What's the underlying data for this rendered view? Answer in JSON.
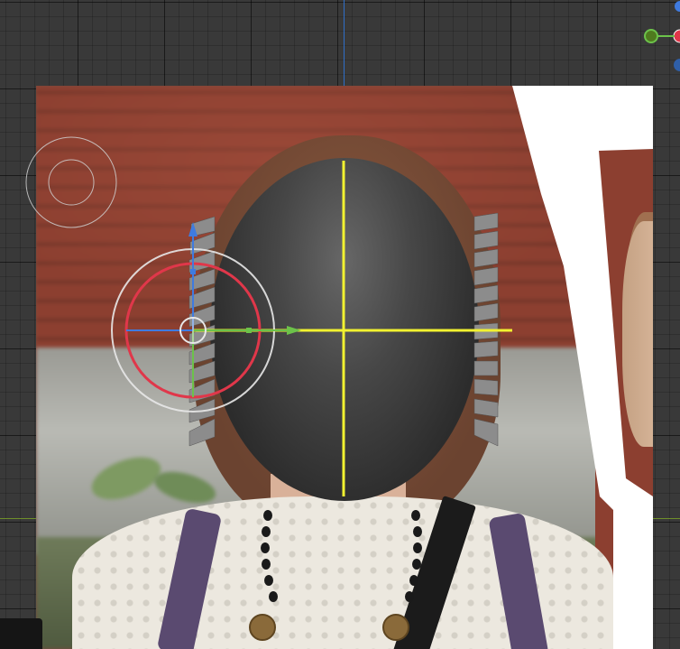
{
  "colors": {
    "canvas_bg": "#393939",
    "axis_x": "#6f8f2a",
    "axis_y": "#2f6fc9",
    "gizmo_red": "#e0374a",
    "gizmo_white": "#e8e8e8",
    "gizmo_green": "#6cc24a",
    "gizmo_blue": "#3f7be0",
    "crosshair_yellow": "#f2f230"
  },
  "viewport": {
    "nodes": [
      {
        "name": "blue-node-top",
        "color": "#3f7be0"
      },
      {
        "name": "red-node",
        "color": "#e0374a"
      },
      {
        "name": "green-node",
        "color": "#6cc24a"
      },
      {
        "name": "blue-node-bottom",
        "color": "#3f7be0"
      }
    ],
    "icons": {
      "move_gizmo": "move-gizmo-icon",
      "rotate_gizmo": "rotate-gizmo-icon",
      "view_circle": "view-circle-icon"
    }
  }
}
